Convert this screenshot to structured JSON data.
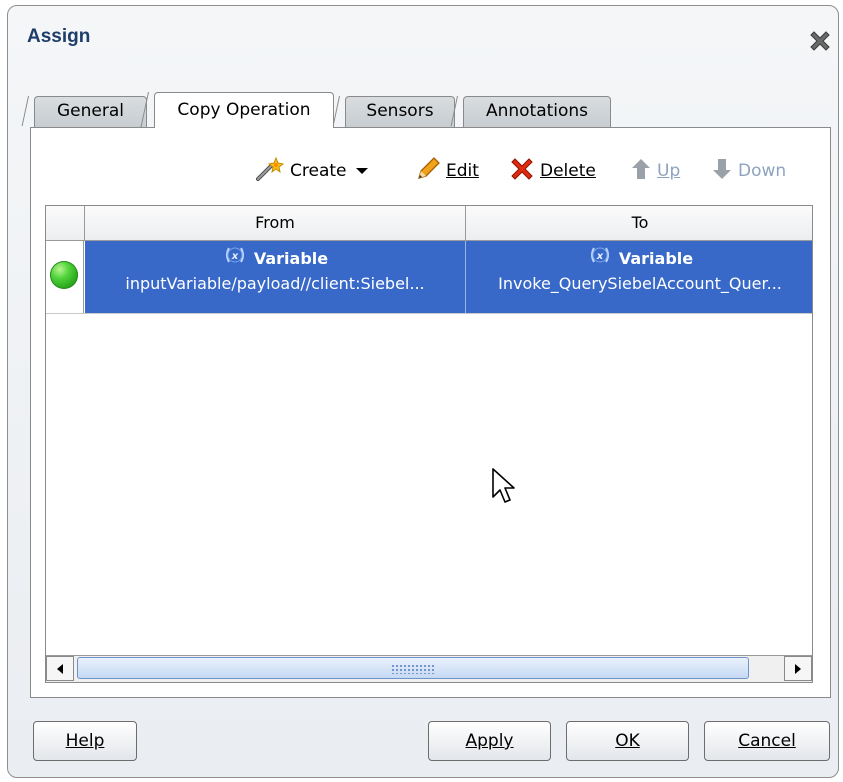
{
  "dialog": {
    "title": "Assign"
  },
  "tabs": [
    {
      "label": "General",
      "active": false
    },
    {
      "label": "Copy Operation",
      "active": true
    },
    {
      "label": "Sensors",
      "active": false
    },
    {
      "label": "Annotations",
      "active": false
    }
  ],
  "toolbar": {
    "create_label": "Create",
    "edit_label": "Edit",
    "delete_label": "Delete",
    "up_label": "Up",
    "down_label": "Down"
  },
  "table": {
    "columns": [
      "From",
      "To"
    ],
    "rows": [
      {
        "from_type": "Variable",
        "from_value": "inputVariable/payload//client:Siebel...",
        "to_type": "Variable",
        "to_value": "Invoke_QuerySiebelAccount_Quer..."
      }
    ]
  },
  "buttons": {
    "help": "Help",
    "apply": "Apply",
    "ok": "OK",
    "cancel": "Cancel"
  },
  "colors": {
    "selection": "#3869c9",
    "title": "#1e3d6b",
    "disabled_text": "#8ea3bf"
  }
}
